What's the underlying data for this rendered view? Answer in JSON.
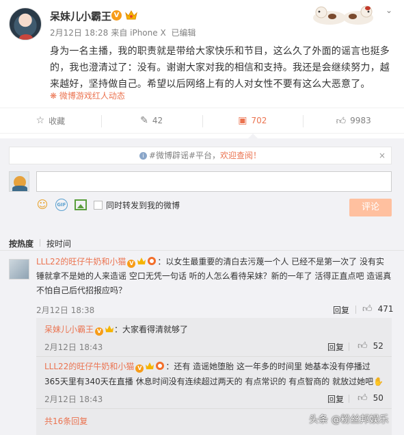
{
  "post": {
    "username": "呆妹儿小霸王",
    "verified_badge": "V",
    "meta": {
      "date": "2月12日 18:28",
      "source": "来自 iPhone X",
      "edited": "已编辑"
    },
    "text_lines": [
      "身为一名主播，我的职责就是带给大家快乐和节目，这么久了外面的谣言也挺多",
      "的，我也澄清过了：没有。谢谢大家对我的相信和支持。我还是会继续努力，越",
      "来越好，坚持做自己。希望以后网络上有的人对女性不要有这么大恶意了。"
    ],
    "source_tag": "微博游戏红人动态"
  },
  "actions": {
    "favorite": "收藏",
    "repost": "42",
    "comment": "702",
    "like": "9983"
  },
  "comment_panel": {
    "notice_prefix": "#微博辟谣#平台，",
    "notice_highlight": "欢迎查阅！",
    "notice_close": "×",
    "input_value": "",
    "repost_label": "同时转发到我的微博",
    "submit_label": "评论",
    "sort_hot": "按热度",
    "sort_time": "按时间"
  },
  "comments": [
    {
      "author": "LLL22的旺仔牛奶和小猫",
      "text_lines": [
        "：以女生最重要的清白去污蔑一个人 已经不是第一次了 没有实",
        "锤就拿不是她的人来造谣 空口无凭一句话 听的人怎么看待呆妹？新的一年了 活得正直点吧 造谣真",
        "不怕自己后代招报应吗？"
      ],
      "time": "2月12日 18:38",
      "reply_label": "回复",
      "likes": "471",
      "replies": [
        {
          "author": "呆妹儿小霸王",
          "text": "：大家看得清就够了",
          "time": "2月12日 18:43",
          "reply_label": "回复",
          "likes": "52"
        },
        {
          "author": "LLL22的旺仔牛奶和小猫",
          "text_lines": [
            "：还有 造谣她堕胎 这一年多的时间里 她基本没有停播过",
            "365天里有340天在直播 休息时间没有连续超过两天的 有点常识的 有点智商的 就放过她吧"
          ],
          "time": "2月12日 18:43",
          "reply_label": "回复",
          "likes": "50"
        }
      ],
      "more_replies": "共16条回复"
    }
  ],
  "watermark": "头条 @粉丝邦娱乐",
  "colors": {
    "accent": "#eb7350",
    "badge": "#f79c19",
    "panel_bg": "#f2f2f5",
    "submit_disabled": "#ffc09f"
  }
}
